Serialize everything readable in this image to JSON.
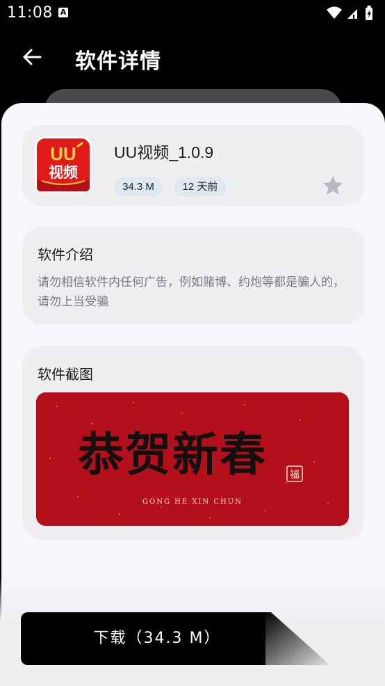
{
  "status_bar": {
    "time": "11:08",
    "app_indicator": "A",
    "icons": [
      "wifi-icon",
      "signal-icon",
      "battery-charging-icon"
    ]
  },
  "app_bar": {
    "title": "软件详情",
    "back_icon": "arrow-left-icon"
  },
  "app_info": {
    "icon_text_top": "UU",
    "icon_text_bottom": "视频",
    "name": "UU视频_1.0.9",
    "size_tag": "34.3 M",
    "time_tag": "12 天前",
    "favorite_icon": "star-icon"
  },
  "intro": {
    "title": "软件介绍",
    "text": "请勿相信软件内任何广告，例如赌博、约炮等都是骗人的，请勿上当受骗"
  },
  "screenshots": {
    "title": "软件截图",
    "image_caption_main": "恭贺新春",
    "image_caption_sub": "GONG HE XIN CHUN",
    "seal_text": "福"
  },
  "download": {
    "label": "下载（34.3 M）"
  },
  "colors": {
    "background": "#000000",
    "sheet": "#f7f7fb",
    "card": "#efeff1",
    "tag": "#dfe7f0",
    "icon_red": "#e11a1a",
    "poster_red": "#b3101b"
  }
}
